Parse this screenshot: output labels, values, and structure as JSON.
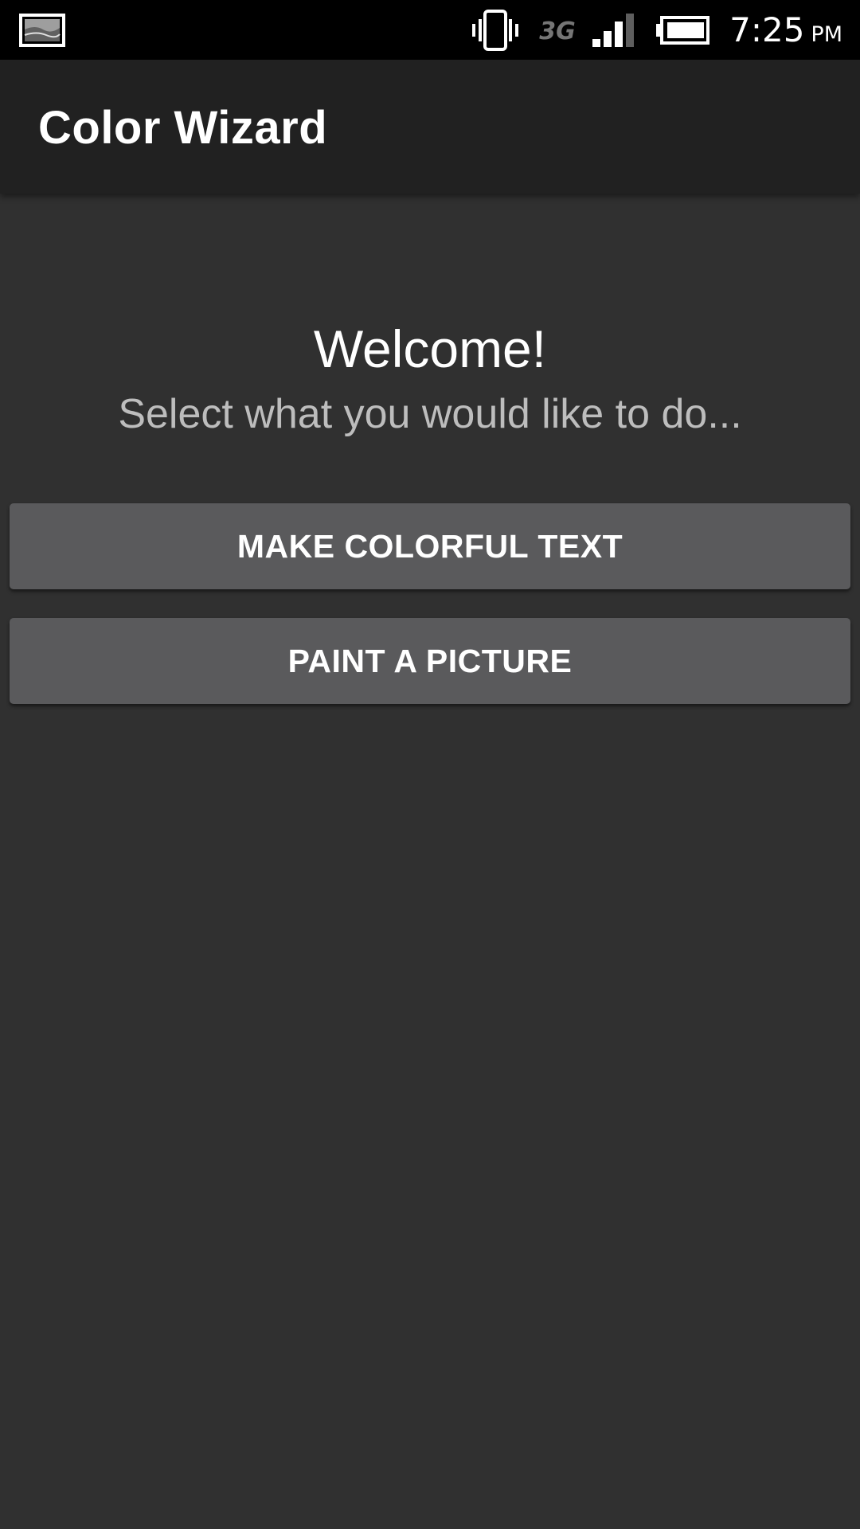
{
  "status_bar": {
    "icons": [
      "image-icon",
      "vibrate-icon",
      "3g-icon",
      "signal-icon",
      "battery-icon"
    ],
    "network_type": "3G",
    "time": "7:25",
    "ampm": "PM"
  },
  "app_bar": {
    "title": "Color Wizard"
  },
  "main": {
    "welcome": "Welcome!",
    "subtitle": "Select what you would like to do...",
    "buttons": [
      {
        "label": "MAKE COLORFUL TEXT"
      },
      {
        "label": "PAINT A PICTURE"
      }
    ]
  },
  "colors": {
    "background": "#303030",
    "app_bar": "#212121",
    "button": "#5a5a5c",
    "status_bar": "#000000"
  }
}
